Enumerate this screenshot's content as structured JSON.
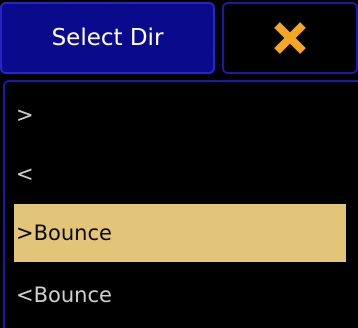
{
  "header": {
    "title": "Select Dir",
    "close_icon": "close-icon",
    "close_icon_color": "#f5a623"
  },
  "colors": {
    "title_bg": "#0a0a8c",
    "selected_bg": "#e3c57a",
    "frame_border": "#1a1aa8"
  },
  "options": [
    {
      "label": ">",
      "selected": false
    },
    {
      "label": "<",
      "selected": false
    },
    {
      "label": ">Bounce",
      "selected": true
    },
    {
      "label": "<Bounce",
      "selected": false
    }
  ]
}
